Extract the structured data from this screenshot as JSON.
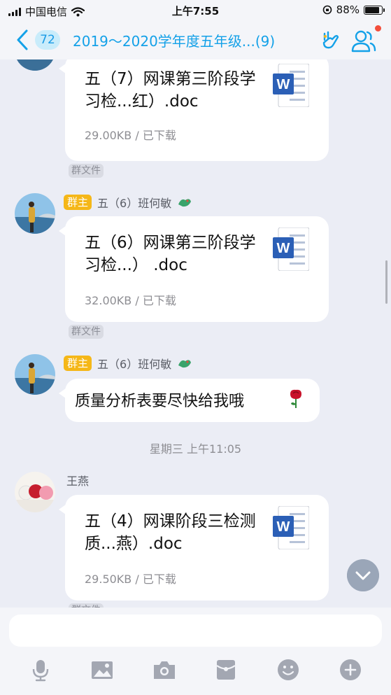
{
  "status_bar": {
    "carrier": "中国电信",
    "time": "上午7:55",
    "battery_percent": "88%",
    "battery_level": 0.88
  },
  "header": {
    "unread_count": "72",
    "title": "2019～2020学年度五年级...(9)"
  },
  "messages": [
    {
      "type": "file",
      "file_name": "五（7）网课第三阶段学习检...红）.doc",
      "file_meta": "29.00KB / 已下载",
      "tag": "群文件"
    },
    {
      "type": "file",
      "badge": "群主",
      "sender": "五（6）班何敏",
      "file_name": "五（6）网课第三阶段学习检...） .doc",
      "file_meta": "32.00KB / 已下载",
      "tag": "群文件"
    },
    {
      "type": "text",
      "badge": "群主",
      "sender": "五（6）班何敏",
      "text": "质量分析表要尽快给我哦"
    },
    {
      "type": "time",
      "text": "星期三 上午11:05"
    },
    {
      "type": "file",
      "sender": "王燕",
      "file_name": "五（4）网课阶段三检测质...燕）.doc",
      "file_meta": "29.50KB / 已下载",
      "tag": "群文件"
    }
  ],
  "icons": {
    "back": "chevron-left-icon",
    "header_action": "hand-gesture-icon",
    "members": "group-members-icon",
    "word": "word-doc-icon",
    "toolbar": [
      "microphone-icon",
      "image-icon",
      "camera-icon",
      "red-packet-icon",
      "emoji-icon",
      "plus-icon"
    ]
  },
  "colors": {
    "accent": "#14a1e8",
    "owner_badge": "#f5b718",
    "word_blue": "#2b5fb6",
    "notification_dot": "#f34e3b"
  }
}
